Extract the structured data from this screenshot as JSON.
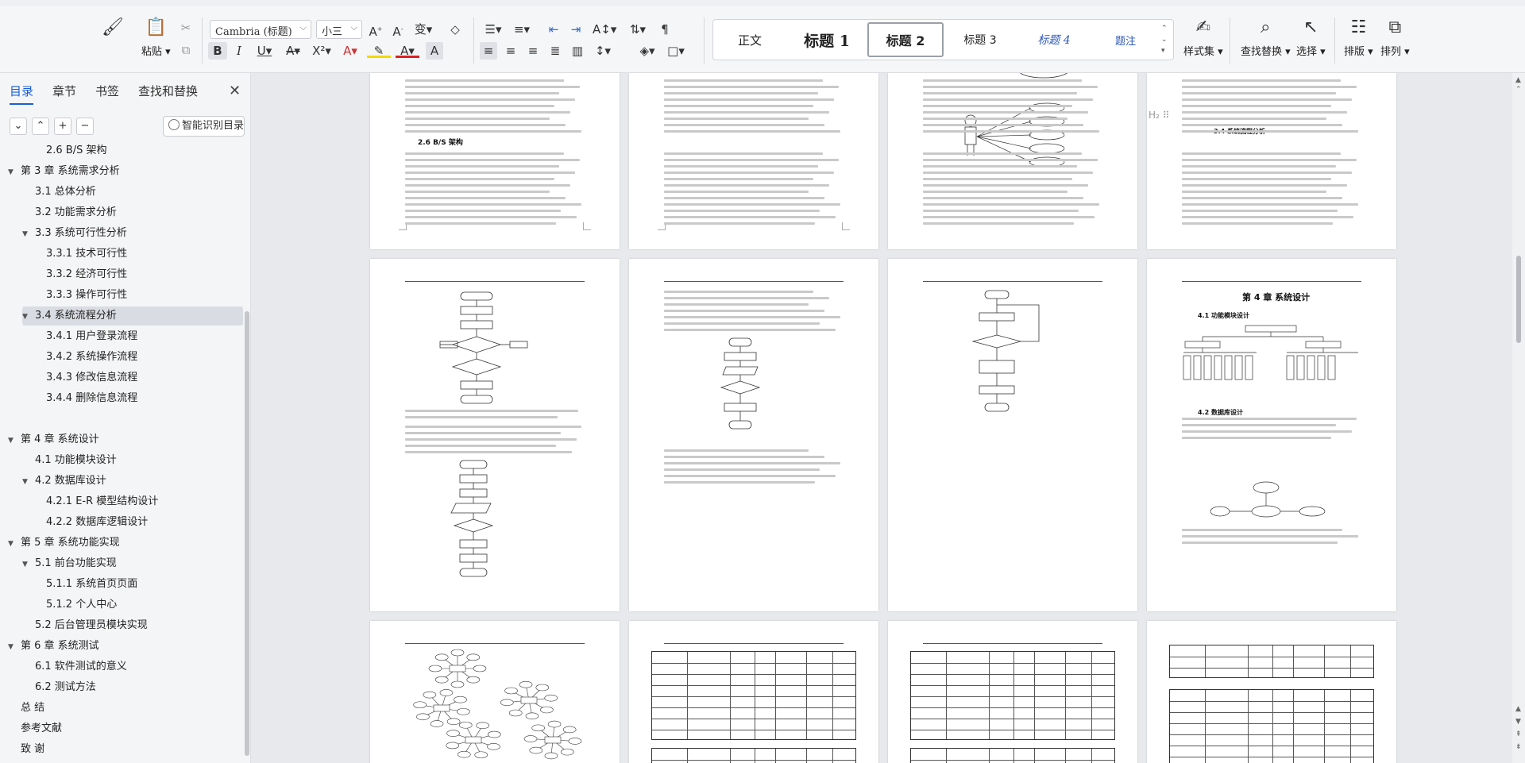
{
  "ribbon": {
    "clipboard": {
      "format_brush": "格式刷",
      "paste": "粘贴"
    },
    "font": {
      "name": "Cambria (标题)",
      "size": "小三"
    },
    "styles": [
      {
        "label": "正文"
      },
      {
        "label": "标题 1"
      },
      {
        "label": "标题 2"
      },
      {
        "label": "标题 3"
      },
      {
        "label": "标题 4"
      },
      {
        "label": "题注"
      }
    ],
    "buttons": {
      "style_set": "样式集",
      "find_replace": "查找替换",
      "select": "选择",
      "layout": "排版",
      "arrange": "排列"
    }
  },
  "sidebar": {
    "tabs": [
      "目录",
      "章节",
      "书签",
      "查找和替换"
    ],
    "smart_toc": "智能识别目录",
    "toc": [
      {
        "label": "2.6 B/S 架构",
        "level": 2,
        "arrow": ""
      },
      {
        "label": "第 3 章  系统需求分析",
        "level": 0,
        "arrow": "▼"
      },
      {
        "label": "3.1 总体分析",
        "level": 1,
        "arrow": ""
      },
      {
        "label": "3.2 功能需求分析",
        "level": 1,
        "arrow": ""
      },
      {
        "label": "3.3  系统可行性分析",
        "level": 1,
        "arrow": "▼"
      },
      {
        "label": "3.3.1 技术可行性",
        "level": 2,
        "arrow": ""
      },
      {
        "label": "3.3.2 经济可行性",
        "level": 2,
        "arrow": ""
      },
      {
        "label": "3.3.3 操作可行性",
        "level": 2,
        "arrow": ""
      },
      {
        "label": "3.4 系统流程分析",
        "level": 1,
        "arrow": "▼",
        "selected": true
      },
      {
        "label": "3.4.1  用户登录流程",
        "level": 2,
        "arrow": ""
      },
      {
        "label": "3.4.2  系统操作流程",
        "level": 2,
        "arrow": ""
      },
      {
        "label": "3.4.3 修改信息流程",
        "level": 2,
        "arrow": ""
      },
      {
        "label": "3.4.4 删除信息流程",
        "level": 2,
        "arrow": ""
      },
      {
        "label": "",
        "level": 0,
        "arrow": ""
      },
      {
        "label": "第 4 章  系统设计",
        "level": 0,
        "arrow": "▼"
      },
      {
        "label": "4.1  功能模块设计",
        "level": 1,
        "arrow": ""
      },
      {
        "label": "4.2  数据库设计",
        "level": 1,
        "arrow": "▼"
      },
      {
        "label": "4.2.1 E-R 模型结构设计",
        "level": 2,
        "arrow": ""
      },
      {
        "label": "4.2.2  数据库逻辑设计",
        "level": 2,
        "arrow": ""
      },
      {
        "label": "第 5 章  系统功能实现",
        "level": 0,
        "arrow": "▼"
      },
      {
        "label": "5.1 前台功能实现",
        "level": 1,
        "arrow": "▼"
      },
      {
        "label": "5.1.1 系统首页页面",
        "level": 2,
        "arrow": ""
      },
      {
        "label": "5.1.2 个人中心",
        "level": 2,
        "arrow": ""
      },
      {
        "label": "5.2 后台管理员模块实现",
        "level": 1,
        "arrow": ""
      },
      {
        "label": "第 6 章  系统测试",
        "level": 0,
        "arrow": "▼"
      },
      {
        "label": "6.1  软件测试的意义",
        "level": 1,
        "arrow": ""
      },
      {
        "label": "6.2  测试方法",
        "level": 1,
        "arrow": ""
      },
      {
        "label": "总  结",
        "level": 0,
        "arrow": ""
      },
      {
        "label": "参考文献",
        "level": 0,
        "arrow": ""
      },
      {
        "label": "致  谢",
        "level": 0,
        "arrow": ""
      }
    ]
  },
  "pages": {
    "p1_heading": "2.6 B/S 架构",
    "p4_heading": "3.4 系统流程分析",
    "p8_title": "第 4 章  系统设计",
    "p8_h1": "4.1  功能模块设计",
    "p8_h2": "4.2  数据库设计"
  }
}
